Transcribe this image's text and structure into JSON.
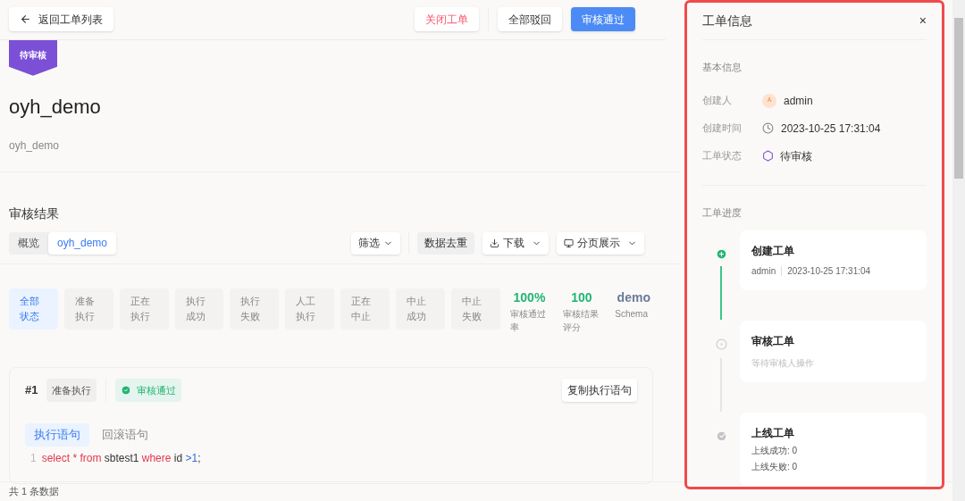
{
  "header": {
    "back_button": "返回工单列表",
    "actions": [
      {
        "label": "关闭工单",
        "kind": "danger"
      },
      {
        "label": "全部驳回",
        "kind": "default"
      },
      {
        "label": "审核通过",
        "kind": "primary"
      }
    ]
  },
  "badge": "待审核",
  "title": "oyh_demo",
  "description": "oyh_demo",
  "section_title": "审核结果",
  "view_tabs": [
    {
      "label": "概览",
      "selected": false
    },
    {
      "label": "oyh_demo",
      "selected": true
    }
  ],
  "toolbar": {
    "filter": "筛选",
    "dedupe": "数据去重",
    "download": "下载",
    "paging": "分页展示"
  },
  "status_filters": [
    {
      "label": "全部状态",
      "selected": true
    },
    {
      "label": "准备执行",
      "selected": false
    },
    {
      "label": "正在执行",
      "selected": false
    },
    {
      "label": "执行成功",
      "selected": false
    },
    {
      "label": "执行失败",
      "selected": false
    },
    {
      "label": "人工执行",
      "selected": false
    },
    {
      "label": "正在中止",
      "selected": false
    },
    {
      "label": "中止成功",
      "selected": false
    },
    {
      "label": "中止失败",
      "selected": false
    }
  ],
  "stats": [
    {
      "value": "100%",
      "label": "审核通过率",
      "kind": "metric"
    },
    {
      "value": "100",
      "label": "审核结果评分",
      "kind": "metric"
    },
    {
      "value": "demo",
      "label": "Schema",
      "kind": "schema"
    }
  ],
  "result_card": {
    "index": "#1",
    "exec_status": "准备执行",
    "audit_status": "审核通过",
    "copy_button": "复制执行语句",
    "sql_tabs": [
      {
        "label": "执行语句",
        "selected": true
      },
      {
        "label": "回滚语句",
        "selected": false
      }
    ],
    "code_lines": [
      {
        "number": "1",
        "tokens": [
          {
            "text": "select",
            "kind": "keyword"
          },
          {
            "text": "*",
            "kind": "keyword"
          },
          {
            "text": "from",
            "kind": "keyword"
          },
          {
            "text": "sbtest1",
            "kind": "plain"
          },
          {
            "text": "where",
            "kind": "keyword"
          },
          {
            "text": "id",
            "kind": "plain"
          },
          {
            "text": ">1",
            "kind": "number"
          },
          {
            "text": ";",
            "kind": "punct"
          }
        ]
      }
    ]
  },
  "footer": {
    "total": "共 1 条数据"
  },
  "drawer": {
    "title": "工单信息",
    "close": "×",
    "basic_title": "基本信息",
    "fields": [
      {
        "label": "创建人",
        "value": "admin",
        "kind": "user",
        "avatar": "A"
      },
      {
        "label": "创建时间",
        "value": "2023-10-25 17:31:04",
        "kind": "time"
      },
      {
        "label": "工单状态",
        "value": "待审核",
        "kind": "status"
      }
    ],
    "progress_title": "工单进度",
    "steps": [
      {
        "title": "创建工单",
        "kind": "done",
        "meta": [
          "admin",
          "2023-10-25 17:31:04"
        ]
      },
      {
        "title": "审核工单",
        "kind": "current",
        "hint": "等待审核人操作"
      },
      {
        "title": "上线工单",
        "kind": "waiting",
        "lines": [
          "上线成功: 0",
          "上线失败: 0"
        ]
      }
    ]
  }
}
